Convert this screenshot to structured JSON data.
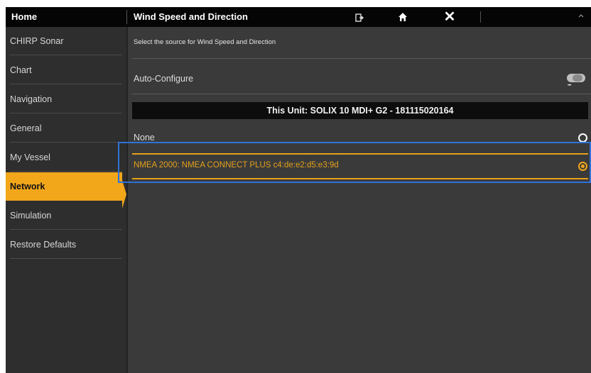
{
  "topbar": {
    "home_title": "Home",
    "page_title": "Wind Speed and Direction",
    "icons": [
      "exit-icon",
      "home-icon",
      "close-icon"
    ],
    "close_glyph": "✕"
  },
  "sidebar": {
    "items": [
      {
        "label": "CHIRP Sonar"
      },
      {
        "label": "Chart"
      },
      {
        "label": "Navigation"
      },
      {
        "label": "General"
      },
      {
        "label": "My Vessel"
      },
      {
        "label": "Network",
        "active": true
      },
      {
        "label": "Simulation"
      },
      {
        "label": "Restore Defaults"
      }
    ]
  },
  "main": {
    "instruction": "Select the source for Wind Speed and Direction",
    "auto_configure": {
      "label": "Auto-Configure",
      "state": "off"
    },
    "unit_header": "This Unit: SOLIX 10 MDI+ G2 - 181115020164",
    "options": [
      {
        "label": "None",
        "selected": false
      },
      {
        "label": "NMEA 2000: NMEA CONNECT PLUS c4:de:e2:d5:e3:9d",
        "selected": true
      }
    ]
  },
  "colors": {
    "accent": "#f2a71b",
    "background": "#3a3a3a",
    "topbar": "#050505",
    "highlight": "#2f72d6"
  }
}
